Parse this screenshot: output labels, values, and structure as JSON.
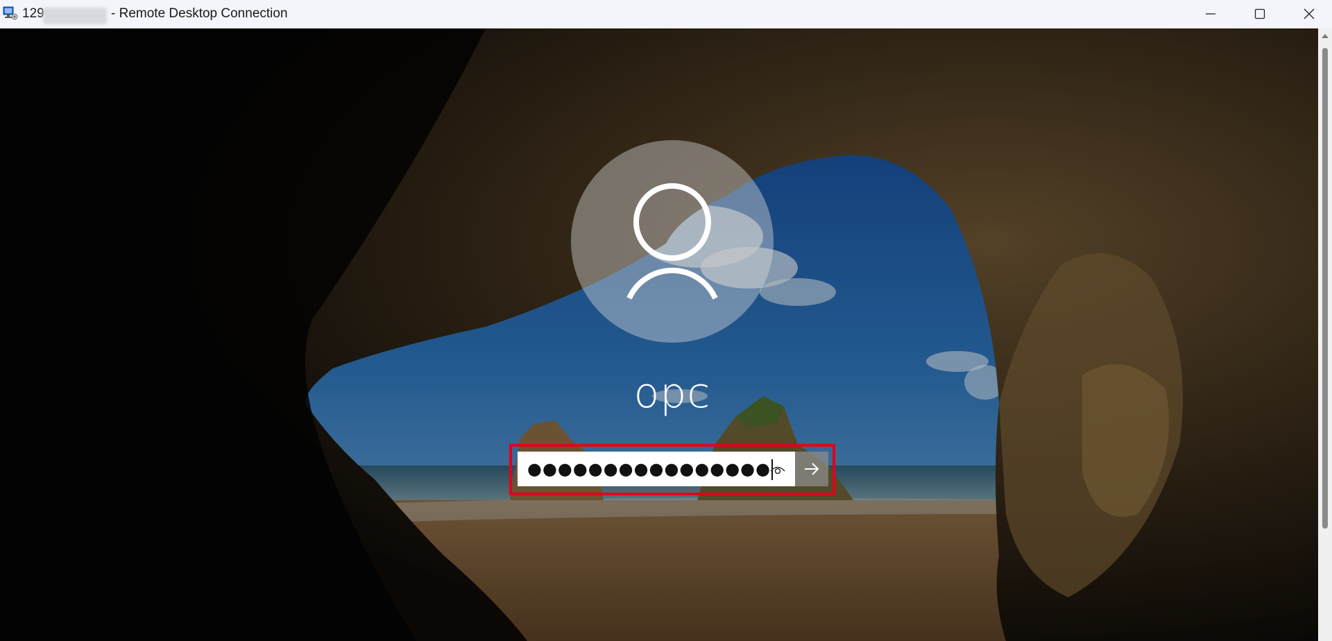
{
  "window": {
    "title_ip_visible": "129",
    "title_text": "- Remote Desktop Connection",
    "controls": [
      "minimize",
      "maximize",
      "close"
    ]
  },
  "icons": {
    "app": "remote-desktop-icon",
    "minimize": "minimize-icon",
    "maximize": "maximize-icon",
    "close": "close-icon",
    "user": "user-icon",
    "reveal": "eye-icon",
    "submit": "arrow-right-icon"
  },
  "login": {
    "username": "opc",
    "password_masked": "●●●●●●●●●●●●●●●●"
  },
  "colors": {
    "highlight": "#e1001a",
    "titlebar": "#f3f5fa"
  }
}
